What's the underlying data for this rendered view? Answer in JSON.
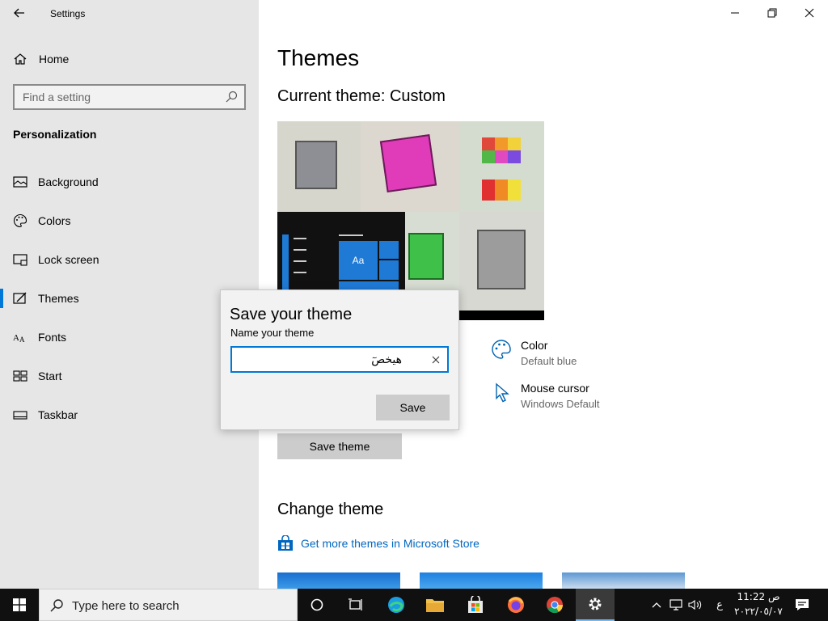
{
  "window": {
    "app_title": "Settings"
  },
  "sidebar": {
    "home_label": "Home",
    "search_placeholder": "Find a setting",
    "section_title": "Personalization",
    "items": [
      {
        "label": "Background",
        "icon": "picture-icon"
      },
      {
        "label": "Colors",
        "icon": "palette-icon"
      },
      {
        "label": "Lock screen",
        "icon": "lock-screen-icon"
      },
      {
        "label": "Themes",
        "icon": "themes-icon",
        "active": true
      },
      {
        "label": "Fonts",
        "icon": "fonts-icon"
      },
      {
        "label": "Start",
        "icon": "start-icon"
      },
      {
        "label": "Taskbar",
        "icon": "taskbar-icon"
      }
    ]
  },
  "main": {
    "title": "Themes",
    "current_theme": "Current theme: Custom",
    "preview_tile_text": "Aa",
    "color": {
      "title": "Color",
      "value": "Default blue"
    },
    "mouse_cursor": {
      "title": "Mouse cursor",
      "value": "Windows Default"
    },
    "save_theme_label": "Save theme",
    "change_theme_title": "Change theme",
    "store_link": "Get more themes in Microsoft Store"
  },
  "dialog": {
    "title": "Save your theme",
    "label": "Name your theme",
    "input_value": "هيخصٓ",
    "save_label": "Save"
  },
  "taskbar": {
    "search_placeholder": "Type here to search",
    "time": "11:22 ص",
    "date": "٢٠٢٢/٠٥/٠٧",
    "language": "ع"
  },
  "colors": {
    "accent": "#0078d7",
    "sidebar_bg": "#e6e6e6",
    "taskbar_bg": "#101010"
  }
}
